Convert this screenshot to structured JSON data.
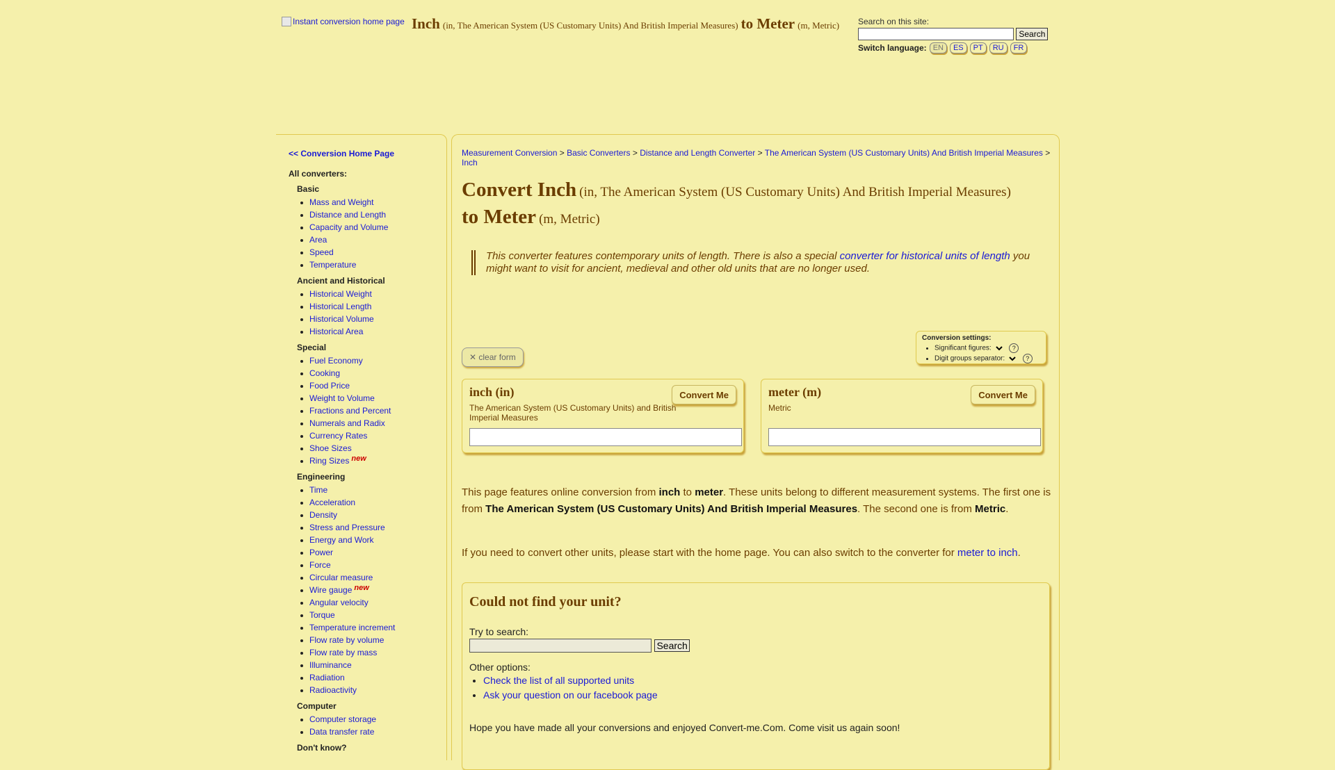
{
  "header": {
    "logo_alt": "Instant conversion home page",
    "title_from": "Inch",
    "title_from_detail": "(in, The American System (US Customary Units) And British Imperial Measures)",
    "title_to": "to Meter",
    "title_to_detail": "(m, Metric)",
    "search_label": "Search on this site:",
    "search_button": "Search",
    "lang_label": "Switch language:",
    "languages": [
      "EN",
      "ES",
      "PT",
      "RU",
      "FR"
    ],
    "active_language": "EN"
  },
  "sidebar": {
    "home_link": "<< Conversion Home Page",
    "all_label": "All converters:",
    "categories": [
      {
        "name": "Basic",
        "items": [
          "Mass and Weight",
          "Distance and Length",
          "Capacity and Volume",
          "Area",
          "Speed",
          "Temperature"
        ]
      },
      {
        "name": "Ancient and Historical",
        "items": [
          "Historical Weight",
          "Historical Length",
          "Historical Volume",
          "Historical Area"
        ]
      },
      {
        "name": "Special",
        "items": [
          "Fuel Economy",
          "Cooking",
          "Food Price",
          "Weight to Volume",
          "Fractions and Percent",
          "Numerals and Radix",
          "Currency Rates",
          "Shoe Sizes",
          "Ring Sizes"
        ]
      },
      {
        "name": "Engineering",
        "items": [
          "Time",
          "Acceleration",
          "Density",
          "Stress and Pressure",
          "Energy and Work",
          "Power",
          "Force",
          "Circular measure",
          "Wire gauge",
          "Angular velocity",
          "Torque",
          "Temperature increment",
          "Flow rate by volume",
          "Flow rate by mass",
          "Illuminance",
          "Radiation",
          "Radioactivity"
        ]
      },
      {
        "name": "Computer",
        "items": [
          "Computer storage",
          "Data transfer rate"
        ]
      },
      {
        "name": "Don't know?",
        "items": []
      }
    ],
    "new_badge": "new",
    "new_items": [
      "Ring Sizes",
      "Wire gauge"
    ]
  },
  "breadcrumb": {
    "links": [
      "Measurement Conversion",
      "Basic Converters",
      "Distance and Length Converter",
      "The American System (US Customary Units) And British Imperial Measures",
      "Inch"
    ],
    "separator": ">"
  },
  "page": {
    "h_convert": "Convert Inch",
    "h_from_detail": "(in, The American System (US Customary Units) And British Imperial Measures)",
    "h_to": "to Meter",
    "h_to_detail": "(m, Metric)",
    "note_before": "This converter features contemporary units of length. There is also a special ",
    "note_link": "converter for historical units of length",
    "note_after": " you might want to visit for ancient, medieval and other old units that are no longer used."
  },
  "settings": {
    "title": "Conversion settings:",
    "sig_figs": "Significant figures:",
    "digit_sep": "Digit groups separator:",
    "help": "?"
  },
  "converter": {
    "clear_label": "✕ clear form",
    "convert_label": "Convert Me",
    "from_name": "inch (in)",
    "from_system": "The American System (US Customary Units) and British Imperial Measures",
    "to_name": "meter (m)",
    "to_system": "Metric"
  },
  "description": {
    "p1_a": "This page features online conversion from ",
    "p1_b": "inch",
    "p1_c": " to ",
    "p1_d": "meter",
    "p1_e": ". These units belong to different measurement systems. The first one is from ",
    "p1_f": "The American System (US Customary Units) And British Imperial Measures",
    "p1_g": ". The second one is from ",
    "p1_h": "Metric",
    "p1_i": ".",
    "p2_a": "If you need to convert other units, please start with the home page. You can also switch to the converter for ",
    "p2_link": "meter to inch",
    "p2_b": "."
  },
  "not_found": {
    "title": "Could not find your unit?",
    "try_label": "Try to search:",
    "search_button": "Search",
    "other_label": "Other options:",
    "links": [
      "Check the list of all supported units",
      "Ask your question on our facebook page"
    ],
    "goodbye": "Hope you have made all your conversions and enjoyed Convert-me.Com. Come visit us again soon!"
  }
}
